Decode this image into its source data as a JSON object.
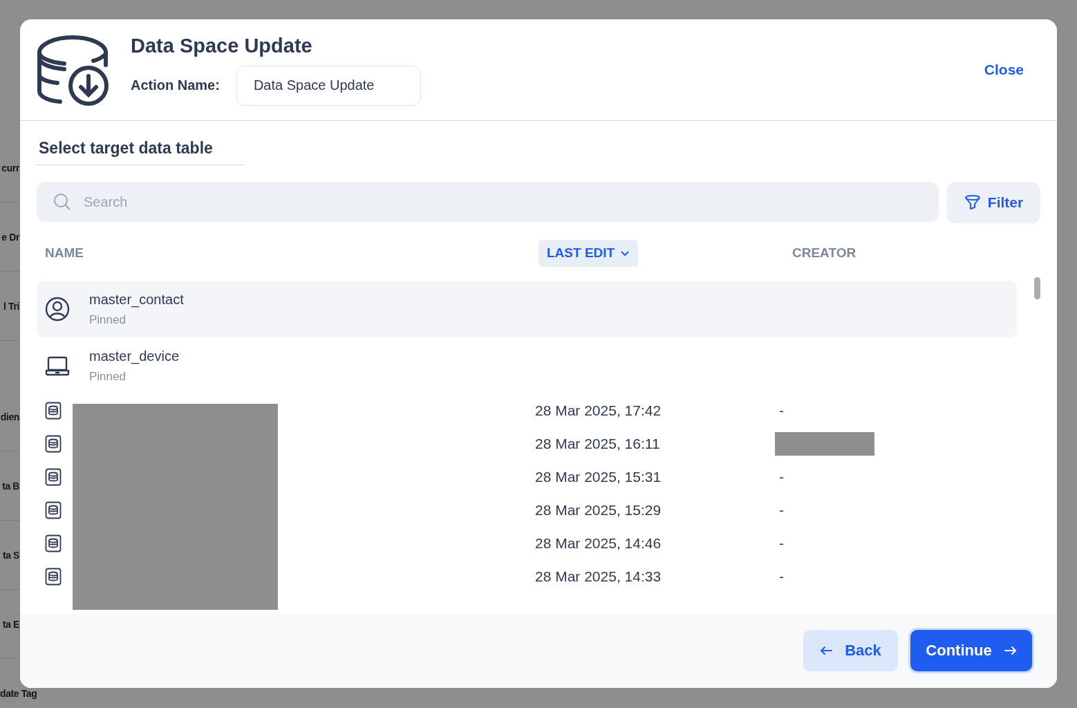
{
  "background_sidebar": {
    "items": [
      "curr",
      "e Dr",
      "l Tri",
      "dien",
      "ta B",
      "ta S",
      "ta E",
      "date Tag"
    ]
  },
  "dialog": {
    "title": "Data Space Update",
    "action_name_label": "Action Name:",
    "action_name_value": "Data Space Update",
    "close": "Close",
    "section_tab": "Select target data table",
    "search": {
      "placeholder": "Search"
    },
    "filter": "Filter",
    "columns": [
      {
        "label": "NAME",
        "sorted": false
      },
      {
        "label": "LAST EDIT",
        "sorted": true
      },
      {
        "label": "CREATOR",
        "sorted": false
      }
    ],
    "pinned_rows": [
      {
        "kind": "contact",
        "name": "master_contact",
        "note": "Pinned",
        "selected": true
      },
      {
        "kind": "device",
        "name": "master_device",
        "note": "Pinned",
        "selected": false
      }
    ],
    "rows": [
      {
        "last_edit": "28 Mar 2025, 17:42",
        "creator": "-",
        "creator_redacted": false
      },
      {
        "last_edit": "28 Mar 2025, 16:11",
        "creator_redacted": true
      },
      {
        "last_edit": "28 Mar 2025, 15:31",
        "creator": "-",
        "creator_redacted": false
      },
      {
        "last_edit": "28 Mar 2025, 15:29",
        "creator": "-",
        "creator_redacted": false
      },
      {
        "last_edit": "28 Mar 2025, 14:46",
        "creator": "-",
        "creator_redacted": false
      },
      {
        "last_edit": "28 Mar 2025, 14:33",
        "creator": "-",
        "creator_redacted": false
      }
    ],
    "buttons": {
      "back": "Back",
      "continue": "Continue"
    }
  }
}
